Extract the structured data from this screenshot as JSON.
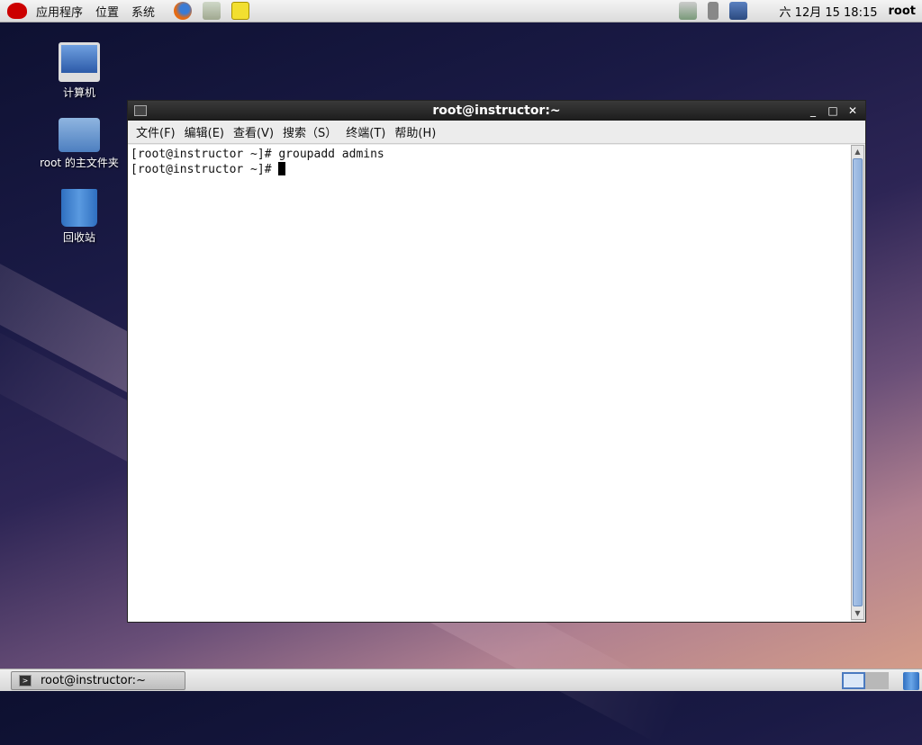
{
  "top_panel": {
    "menus": [
      "应用程序",
      "位置",
      "系统"
    ],
    "clock": "六 12月 15 18:15",
    "user": "root"
  },
  "desktop": {
    "icons": [
      {
        "label": "计算机"
      },
      {
        "label": "root 的主文件夹"
      },
      {
        "label": "回收站"
      }
    ]
  },
  "terminal": {
    "title": "root@instructor:~",
    "menus": [
      "文件(F)",
      "编辑(E)",
      "查看(V)",
      "搜索（S）",
      "终端(T)",
      "帮助(H)"
    ],
    "lines": [
      "[root@instructor ~]# groupadd admins",
      "[root@instructor ~]# "
    ]
  },
  "taskbar": {
    "task_label": "root@instructor:~"
  }
}
